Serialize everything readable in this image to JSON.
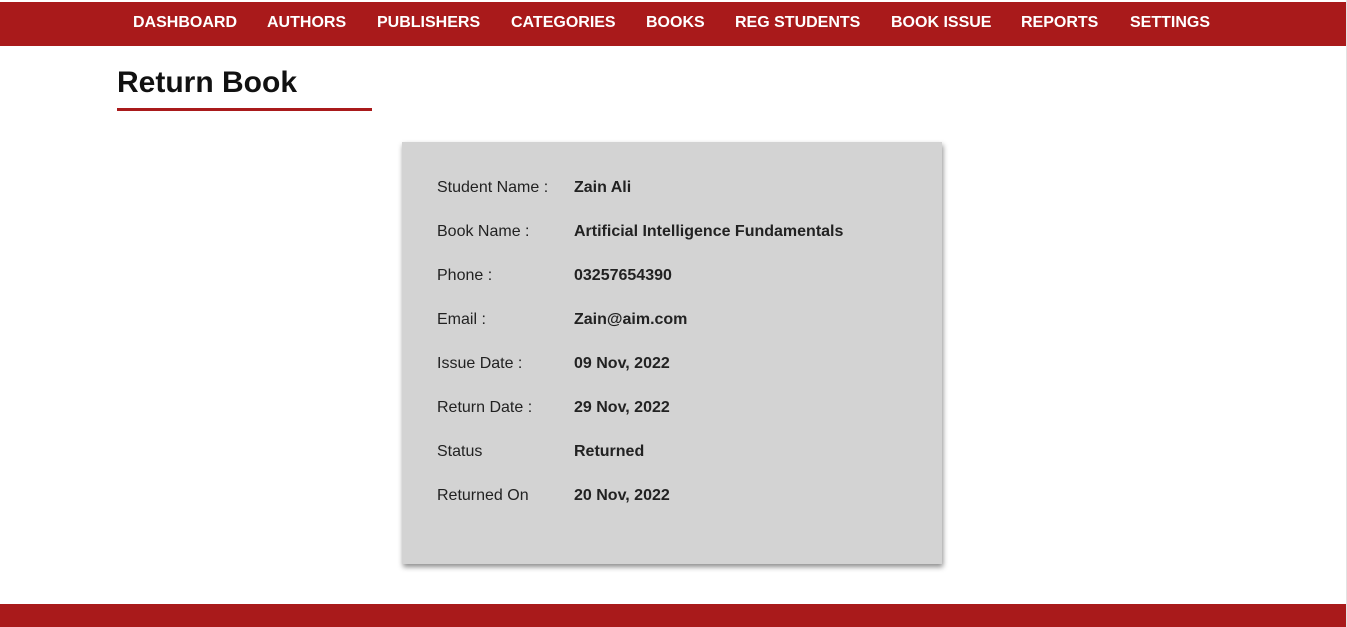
{
  "nav": {
    "items": [
      {
        "label": "DASHBOARD"
      },
      {
        "label": "AUTHORS"
      },
      {
        "label": "PUBLISHERS"
      },
      {
        "label": "CATEGORIES"
      },
      {
        "label": "BOOKS"
      },
      {
        "label": "REG STUDENTS"
      },
      {
        "label": "BOOK ISSUE"
      },
      {
        "label": "REPORTS"
      },
      {
        "label": "SETTINGS"
      }
    ]
  },
  "page": {
    "title": "Return Book"
  },
  "details": {
    "rows": [
      {
        "label": "Student Name :",
        "value": "Zain Ali"
      },
      {
        "label": "Book Name :",
        "value": "Artificial Intelligence Fundamentals"
      },
      {
        "label": "Phone :",
        "value": "03257654390"
      },
      {
        "label": "Email :",
        "value": "Zain@aim.com"
      },
      {
        "label": "Issue Date :",
        "value": "09 Nov, 2022"
      },
      {
        "label": "Return Date :",
        "value": "29 Nov, 2022"
      },
      {
        "label": "Status",
        "value": "Returned"
      },
      {
        "label": "Returned On",
        "value": "20 Nov, 2022"
      }
    ]
  },
  "colors": {
    "brand": "#a91a1b",
    "card_bg": "#d3d3d3"
  }
}
